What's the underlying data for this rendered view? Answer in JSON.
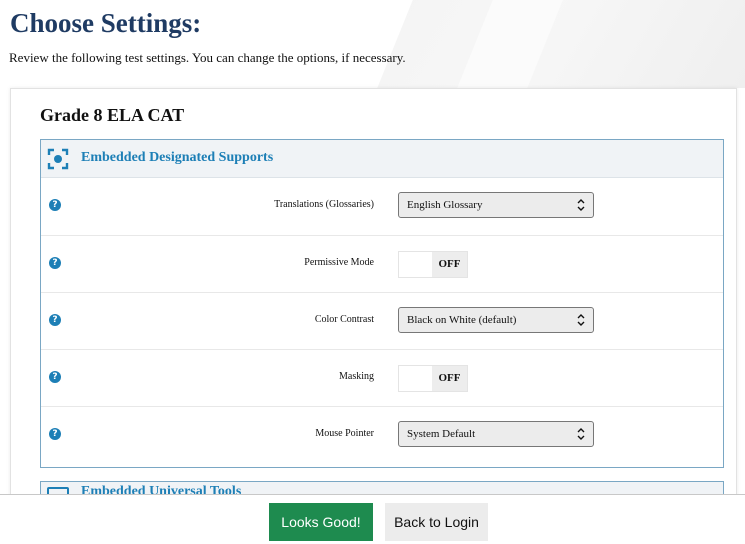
{
  "header": {
    "title": "Choose Settings:",
    "subtitle": "Review the following test settings. You can change the options, if necessary."
  },
  "test": {
    "name": "Grade 8 ELA CAT"
  },
  "sections": {
    "embedded_designated_supports": {
      "title": "Embedded Designated Supports",
      "icon": "target-icon"
    },
    "next_section": {
      "title": "Embedded Universal Tools",
      "icon": "tools-icon"
    }
  },
  "settings": [
    {
      "label": "Translations (Glossaries)",
      "type": "select",
      "value": "English Glossary"
    },
    {
      "label": "Permissive Mode",
      "type": "toggle",
      "value": "OFF"
    },
    {
      "label": "Color Contrast",
      "type": "select",
      "value": "Black on White (default)"
    },
    {
      "label": "Masking",
      "type": "toggle",
      "value": "OFF"
    },
    {
      "label": "Mouse Pointer",
      "type": "select",
      "value": "System Default"
    }
  ],
  "help_icon_glyph": "?",
  "footer": {
    "primary_label": "Looks Good!",
    "secondary_label": "Back to Login"
  },
  "colors": {
    "title": "#1f3b63",
    "accent": "#1d7fb6",
    "primary_button": "#1e8b4f"
  }
}
